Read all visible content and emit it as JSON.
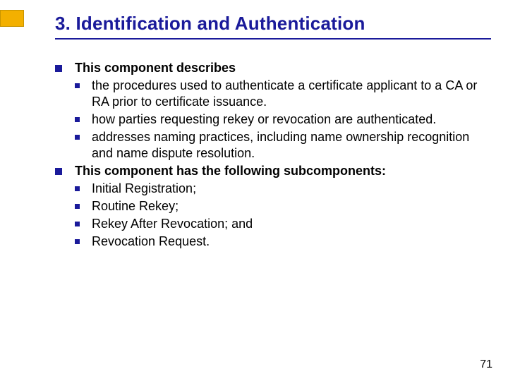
{
  "title": "3. Identification and Authentication",
  "groups": [
    {
      "heading": "This component describes",
      "items": [
        "the procedures used to authenticate a certificate applicant to a CA or RA prior to certificate issuance.",
        "how parties requesting rekey or revocation are authenticated.",
        "addresses naming practices, including name ownership recognition and name dispute resolution."
      ]
    },
    {
      "heading": "This component has the following subcomponents:",
      "items": [
        "Initial Registration;",
        "Routine Rekey;",
        "Rekey After Revocation; and",
        "Revocation Request."
      ]
    }
  ],
  "page_number": "71"
}
